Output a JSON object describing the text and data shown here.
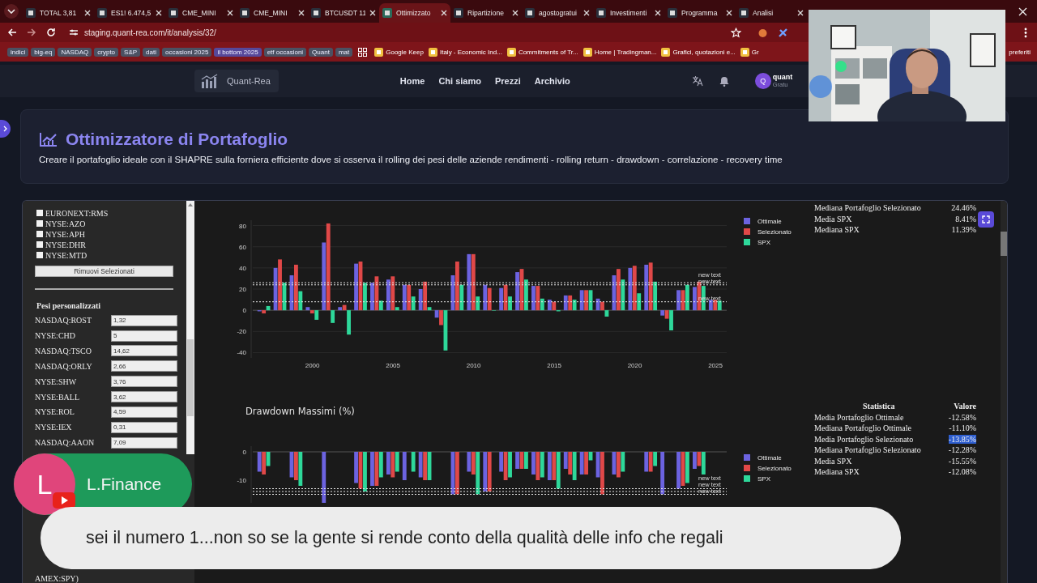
{
  "browser": {
    "tabs": [
      {
        "title": "TOTAL 3,81",
        "selected": false
      },
      {
        "title": "ES1! 6.474,5",
        "selected": false
      },
      {
        "title": "CME_MINI",
        "selected": false
      },
      {
        "title": "CME_MINI",
        "selected": false
      },
      {
        "title": "BTCUSDT 11",
        "selected": false
      },
      {
        "title": "Ottimizzato",
        "selected": true
      },
      {
        "title": "Ripartizione",
        "selected": false
      },
      {
        "title": "agostogratui",
        "selected": false
      },
      {
        "title": "Investimenti",
        "selected": false
      },
      {
        "title": "Programma",
        "selected": false
      },
      {
        "title": "Analisi",
        "selected": false
      }
    ],
    "address": "staging.quant-rea.com/it/analysis/32/",
    "bookmarks": [
      {
        "label": "indici",
        "kind": "folder",
        "color": "#4b5162"
      },
      {
        "label": "big-eq",
        "kind": "folder",
        "color": "#4b5162"
      },
      {
        "label": "NASDAQ",
        "kind": "folder",
        "color": "#4b5162"
      },
      {
        "label": "crypto",
        "kind": "folder",
        "color": "#4b5162"
      },
      {
        "label": "S&P",
        "kind": "folder",
        "color": "#4b5162"
      },
      {
        "label": "dati",
        "kind": "folder",
        "color": "#4b5162"
      },
      {
        "label": "occasioni 2025",
        "kind": "folder",
        "color": "#4b5162"
      },
      {
        "label": "il bottom 2025",
        "kind": "folder",
        "color": "#56489a"
      },
      {
        "label": "etf occasioni",
        "kind": "folder",
        "color": "#4b5162"
      },
      {
        "label": "Quant",
        "kind": "folder",
        "color": "#4b5162"
      },
      {
        "label": "mat",
        "kind": "folder",
        "color": "#4b5162"
      },
      {
        "kind": "apps"
      },
      {
        "label": "Google Keep",
        "kind": "link"
      },
      {
        "label": "Italy - Economic Ind...",
        "kind": "link"
      },
      {
        "label": "Commitments of Tr...",
        "kind": "link"
      },
      {
        "label": "Home | Tradingman...",
        "kind": "link"
      },
      {
        "label": "Grafici, quotazioni e...",
        "kind": "link"
      },
      {
        "label": "Gr",
        "kind": "link"
      }
    ],
    "all_bookmarks": "preferiti"
  },
  "site_header": {
    "brand": "Quant-Rea",
    "nav": [
      "Home",
      "Chi siamo",
      "Prezzi",
      "Archivio"
    ],
    "avatar": "Q",
    "user_name": "quant",
    "user_plan": "Gratu"
  },
  "page_title": "Ottimizzatore di Portafoglio",
  "description": "Creare il portafoglio ideale con il SHAPRE sulla forniera efficiente dove si osserva il rolling dei pesi delle aziende rendimenti - rolling return - drawdown - correlazione - recovery time",
  "sidebar": {
    "tickers": [
      {
        "label": "EURONEXT:RMS",
        "checked": false
      },
      {
        "label": "NYSE:AZO",
        "checked": false
      },
      {
        "label": "NYSE:APH",
        "checked": false
      },
      {
        "label": "NYSE:DHR",
        "checked": false
      },
      {
        "label": "NYSE:MTD",
        "checked": false
      }
    ],
    "remove_button": "Rimuovi Selezionati",
    "weights_heading": "Pesi personalizzati",
    "weights": [
      {
        "ticker": "NASDAQ:ROST",
        "value": "1,32"
      },
      {
        "ticker": "NYSE:CHD",
        "value": "5"
      },
      {
        "ticker": "NASDAQ:TSCO",
        "value": "14,62"
      },
      {
        "ticker": "NASDAQ:ORLY",
        "value": "2,66"
      },
      {
        "ticker": "NYSE:SHW",
        "value": "3,76"
      },
      {
        "ticker": "NYSE:BALL",
        "value": "3,62"
      },
      {
        "ticker": "NYSE:ROL",
        "value": "4,59"
      },
      {
        "ticker": "NYSE:IEX",
        "value": "0,31"
      },
      {
        "ticker": "NASDAQ:AAON",
        "value": "7,09"
      }
    ],
    "footer_text": "AMEX:SPY)"
  },
  "returns_chart": {
    "chart_data": {
      "type": "bar",
      "x": [
        1997,
        1998,
        1999,
        2000,
        2001,
        2002,
        2003,
        2004,
        2005,
        2006,
        2007,
        2008,
        2009,
        2010,
        2011,
        2012,
        2013,
        2014,
        2015,
        2016,
        2017,
        2018,
        2019,
        2020,
        2021,
        2022,
        2023,
        2024,
        2025
      ],
      "series": [
        {
          "name": "Ottimale",
          "color": "#6c63e0",
          "values": [
            -1,
            40,
            33,
            3,
            64,
            3,
            44,
            26,
            29,
            24,
            20,
            -7,
            33,
            53,
            24,
            21,
            36,
            23,
            10,
            14,
            19,
            11,
            33,
            40,
            43,
            -5,
            19,
            22,
            10
          ]
        },
        {
          "name": "Selezionato",
          "color": "#e04848",
          "values": [
            -3,
            48,
            43,
            -3,
            82,
            5,
            46,
            32,
            32,
            24,
            27,
            -14,
            46,
            53,
            21,
            24,
            39,
            23,
            8,
            14,
            19,
            8,
            39,
            42,
            45,
            -8,
            19,
            27,
            10
          ]
        },
        {
          "name": "SPX",
          "color": "#2ed89a",
          "values": [
            4,
            26,
            18,
            -9,
            -12,
            -23,
            26,
            9,
            3,
            13,
            3,
            -38,
            24,
            13,
            0,
            13,
            29,
            11,
            -1,
            10,
            19,
            -6,
            29,
            16,
            27,
            -19,
            24,
            23,
            9
          ]
        }
      ],
      "xlim": [
        1996.3,
        2025.7
      ],
      "ylim": [
        -45,
        85
      ],
      "xticks": [
        2000,
        2005,
        2010,
        2015,
        2020,
        2025
      ],
      "yticks": [
        -40,
        -20,
        0,
        20,
        40,
        60,
        80
      ],
      "grid": true,
      "legend": "right",
      "ref_lines": [
        {
          "axis": "y",
          "value": 26,
          "label": "new text"
        },
        {
          "axis": "y",
          "value": 24,
          "label": "new text"
        },
        {
          "axis": "y",
          "value": 8,
          "label": "new text"
        }
      ]
    }
  },
  "returns_stats": [
    {
      "label": "Mediana Portafoglio Selezionato",
      "value": "24.46%"
    },
    {
      "label": "Media SPX",
      "value": "8.41%"
    },
    {
      "label": "Mediana SPX",
      "value": "11.39%"
    }
  ],
  "drawdown_chart": {
    "chart_data": {
      "type": "bar",
      "title": "Drawdown Massimi (%)",
      "x": [
        1997,
        1998,
        1999,
        2000,
        2001,
        2002,
        2003,
        2004,
        2005,
        2006,
        2007,
        2008,
        2009,
        2010,
        2011,
        2012,
        2013,
        2014,
        2015,
        2016,
        2017,
        2018,
        2019,
        2020,
        2021,
        2022,
        2023,
        2024
      ],
      "series": [
        {
          "name": "Ottimale",
          "color": "#6c63e0",
          "values": [
            -7,
            null,
            -9,
            null,
            -18,
            null,
            -11,
            -12,
            -8,
            -10,
            -9,
            null,
            -15,
            -7,
            -14,
            -7,
            -6,
            -8,
            -10,
            -6,
            -8,
            -9,
            -8,
            null,
            -7,
            -15,
            -13,
            -6
          ]
        },
        {
          "name": "Selezionato",
          "color": "#e04848",
          "values": [
            -8,
            null,
            -10,
            null,
            null,
            null,
            -13,
            -12,
            -9,
            null,
            -10,
            null,
            -15,
            -8,
            -14,
            -10,
            -6,
            -10,
            -10,
            -8,
            -8,
            -15,
            -9,
            null,
            -7,
            null,
            -12,
            -5
          ]
        },
        {
          "name": "SPX",
          "color": "#2ed89a",
          "values": [
            -5,
            null,
            -12,
            null,
            null,
            null,
            -14,
            -9,
            -7,
            -7,
            -10,
            null,
            null,
            -15,
            null,
            -9,
            -6,
            -9,
            -13,
            -10,
            -3,
            null,
            -7,
            null,
            -5,
            null,
            -11,
            -8
          ]
        }
      ],
      "xlim": [
        1996.3,
        2025.7
      ],
      "ylim": [
        -18,
        2
      ],
      "yticks": [
        -10,
        0
      ],
      "legend": "right",
      "ref_lines": [
        {
          "axis": "y",
          "value": -13,
          "label": "new text"
        },
        {
          "axis": "y",
          "value": -14,
          "label": "new text"
        },
        {
          "axis": "y",
          "value": -15,
          "label": "new text"
        }
      ]
    }
  },
  "drawdown_stats": {
    "columns": [
      "Statistica",
      "Valore"
    ],
    "rows": [
      {
        "label": "Media Portafoglio Ottimale",
        "value": "-12.58%",
        "highlighted": false
      },
      {
        "label": "Mediana Portafoglio Ottimale",
        "value": "-11.10%",
        "highlighted": false
      },
      {
        "label": "Media Portafoglio Selezionato",
        "value": "-13.85%",
        "highlighted": true
      },
      {
        "label": "Mediana Portafoglio Selezionato",
        "value": "-12.28%",
        "highlighted": false
      },
      {
        "label": "Media SPX",
        "value": "-15.55%",
        "highlighted": false
      },
      {
        "label": "Mediana SPX",
        "value": "-12.08%",
        "highlighted": false
      }
    ]
  },
  "live_comment": {
    "author": "L.Finance",
    "avatar": "L",
    "text": "sei il numero 1...non so se la gente si rende conto della qualità delle info che regali"
  }
}
